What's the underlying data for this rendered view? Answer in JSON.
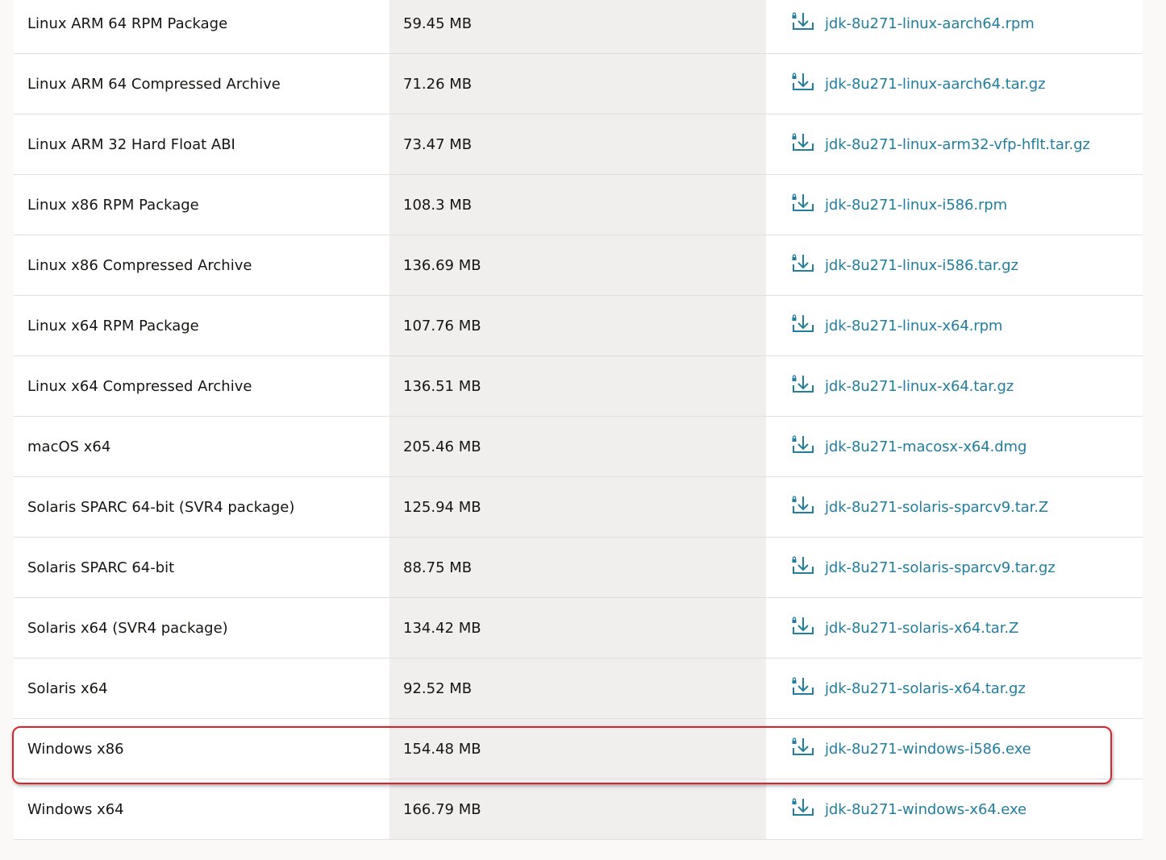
{
  "rows": [
    {
      "product": "Linux ARM 64 RPM Package",
      "size": "59.45 MB",
      "file": "jdk-8u271-linux-aarch64.rpm"
    },
    {
      "product": "Linux ARM 64 Compressed Archive",
      "size": "71.26 MB",
      "file": "jdk-8u271-linux-aarch64.tar.gz"
    },
    {
      "product": "Linux ARM 32 Hard Float ABI",
      "size": "73.47 MB",
      "file": "jdk-8u271-linux-arm32-vfp-hflt.tar.gz"
    },
    {
      "product": "Linux x86 RPM Package",
      "size": "108.3 MB",
      "file": "jdk-8u271-linux-i586.rpm"
    },
    {
      "product": "Linux x86 Compressed Archive",
      "size": "136.69 MB",
      "file": "jdk-8u271-linux-i586.tar.gz"
    },
    {
      "product": "Linux x64 RPM Package",
      "size": "107.76 MB",
      "file": "jdk-8u271-linux-x64.rpm"
    },
    {
      "product": "Linux x64 Compressed Archive",
      "size": "136.51 MB",
      "file": "jdk-8u271-linux-x64.tar.gz"
    },
    {
      "product": "macOS x64",
      "size": "205.46 MB",
      "file": "jdk-8u271-macosx-x64.dmg"
    },
    {
      "product": "Solaris SPARC 64-bit (SVR4 package)",
      "size": "125.94 MB",
      "file": "jdk-8u271-solaris-sparcv9.tar.Z"
    },
    {
      "product": "Solaris SPARC 64-bit",
      "size": "88.75 MB",
      "file": "jdk-8u271-solaris-sparcv9.tar.gz"
    },
    {
      "product": "Solaris x64 (SVR4 package)",
      "size": "134.42 MB",
      "file": "jdk-8u271-solaris-x64.tar.Z"
    },
    {
      "product": "Solaris x64",
      "size": "92.52 MB",
      "file": "jdk-8u271-solaris-x64.tar.gz"
    },
    {
      "product": "Windows x86",
      "size": "154.48 MB",
      "file": "jdk-8u271-windows-i586.exe"
    },
    {
      "product": "Windows x64",
      "size": "166.79 MB",
      "file": "jdk-8u271-windows-x64.exe"
    }
  ],
  "icon": "locked-download-icon",
  "colors": {
    "link": "#227e9e",
    "highlight": "#d9252a",
    "size_column_bg": "#f0efed"
  },
  "highlighted_row": "Windows x86"
}
